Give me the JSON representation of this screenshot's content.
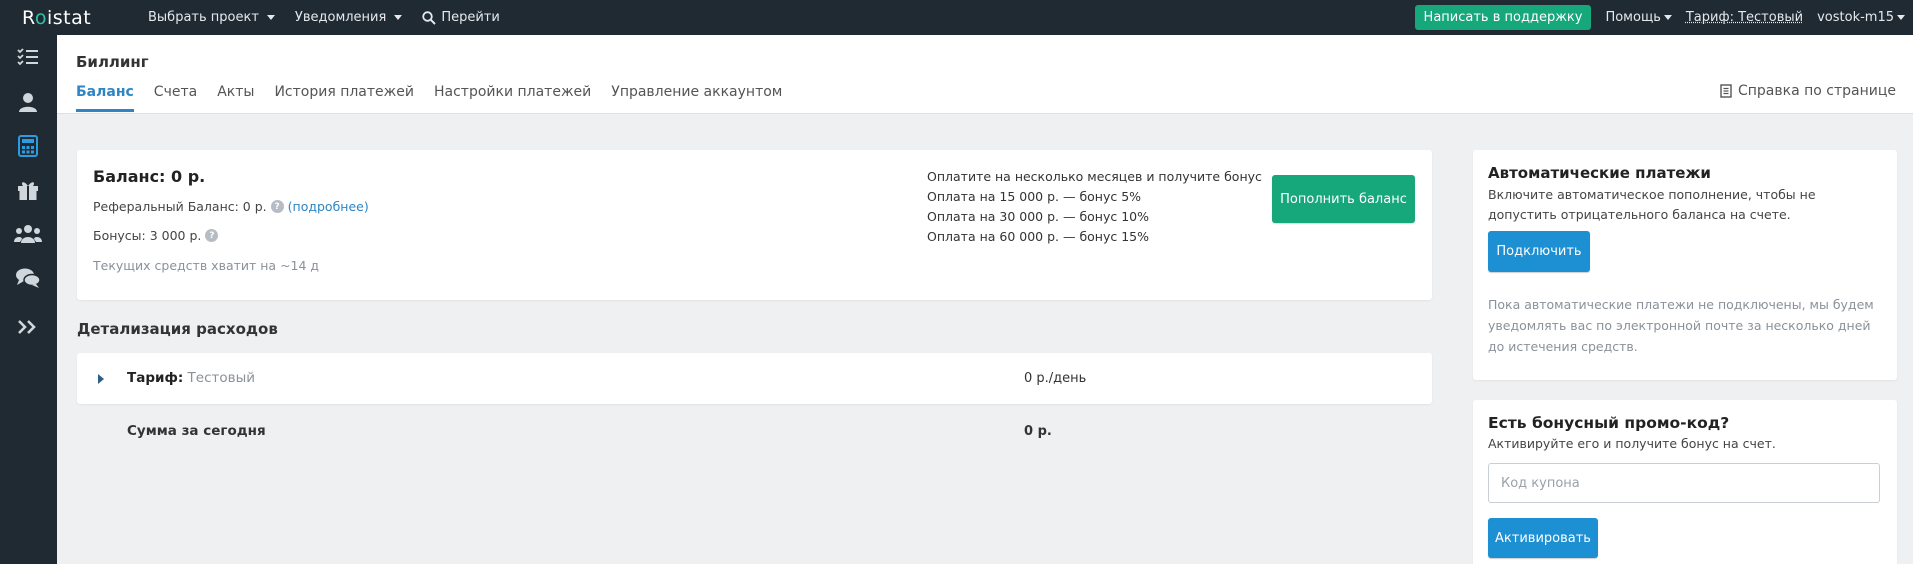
{
  "topbar": {
    "logo": "Roistat",
    "nav": [
      {
        "label": "Выбрать проект"
      },
      {
        "label": "Уведомления"
      },
      {
        "label": "Перейти"
      }
    ],
    "support_button": "Написать в поддержку",
    "help": "Помощь",
    "tariff": "Тариф: Тестовый",
    "user": "vostok-m15"
  },
  "sidebar": {
    "icons": [
      "tasks-icon",
      "user-icon",
      "calculator-icon",
      "gift-icon",
      "users-icon",
      "chat-icon",
      "expand-icon"
    ]
  },
  "header": {
    "title": "Биллинг",
    "tabs": [
      {
        "label": "Баланс",
        "active": true
      },
      {
        "label": "Счета"
      },
      {
        "label": "Акты"
      },
      {
        "label": "История платежей"
      },
      {
        "label": "Настройки платежей"
      },
      {
        "label": "Управление аккаунтом"
      }
    ],
    "help_link": "Справка по странице"
  },
  "balance": {
    "title": "Баланс: 0 р.",
    "referral_label": "Реферальный Баланс: 0 р.",
    "referral_more": "(подробнее)",
    "bonuses": "Бонусы: 3 000 р.",
    "runway": "Текущих средств хватит на ~14 д",
    "offer_lines": [
      "Оплатите на несколько месяцев и получите бонус",
      "Оплата на 15 000 р. — бонус 5%",
      "Оплата на 30 000 р. — бонус 10%",
      "Оплата на 60 000 р. — бонус 15%"
    ],
    "topup_button": "Пополнить баланс"
  },
  "expenses": {
    "title": "Детализация расходов",
    "tariff_key": "Тариф:",
    "tariff_value": "Тестовый",
    "tariff_amount": "0 р./день",
    "sum_label": "Сумма за сегодня",
    "sum_amount": "0 р."
  },
  "auto_payments": {
    "title": "Автоматические платежи",
    "description": "Включите автоматическое пополнение, чтобы не допустить отрицательного баланса на счете.",
    "button": "Подключить",
    "note": "Пока автоматические платежи не подключены, мы будем уведомлять вас по электронной почте за несколько дней до истечения средств."
  },
  "promo": {
    "title": "Есть бонусный промо-код?",
    "description": "Активируйте его и получите бонус на счет.",
    "placeholder": "Код купона",
    "button": "Активировать"
  },
  "colors": {
    "topbar_bg": "#1f2a33",
    "accent_green": "#16a77a",
    "accent_blue": "#1d8fd3",
    "link_blue": "#2d86c3",
    "page_bg": "#eef0f2"
  }
}
